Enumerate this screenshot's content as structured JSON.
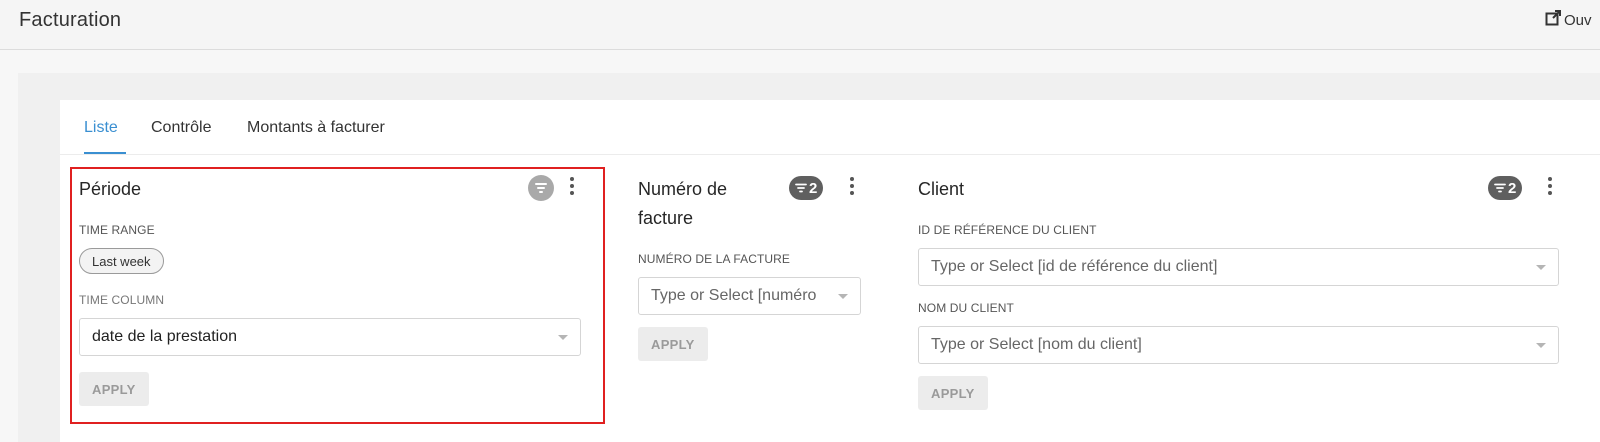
{
  "header": {
    "title": "Facturation",
    "open_label": "Ouv"
  },
  "tabs": [
    {
      "label": "Liste",
      "active": true
    },
    {
      "label": "Contrôle",
      "active": false
    },
    {
      "label": "Montants à facturer",
      "active": false
    }
  ],
  "periode": {
    "title": "Période",
    "time_range_label": "TIME RANGE",
    "time_range_value": "Last week",
    "time_column_label": "TIME COLUMN",
    "time_column_value": "date de la prestation",
    "apply_label": "APPLY",
    "filter_icon": "filter-icon",
    "menu_icon": "more-vertical-icon"
  },
  "numero": {
    "title_line1": "Numéro de",
    "title_line2": "facture",
    "badge_count": "2",
    "field_label": "NUMÉRO DE LA FACTURE",
    "field_placeholder": "Type or Select [numéro",
    "apply_label": "APPLY"
  },
  "client": {
    "title": "Client",
    "badge_count": "2",
    "ref_label": "ID DE RÉFÉRENCE DU CLIENT",
    "ref_placeholder": "Type or Select [id de référence du client]",
    "name_label": "NOM DU CLIENT",
    "name_placeholder": "Type or Select [nom du client]",
    "apply_label": "APPLY"
  },
  "colors": {
    "accent": "#3a8fd1",
    "highlight_border": "#e02020",
    "badge_bg": "#5f5f5f"
  }
}
